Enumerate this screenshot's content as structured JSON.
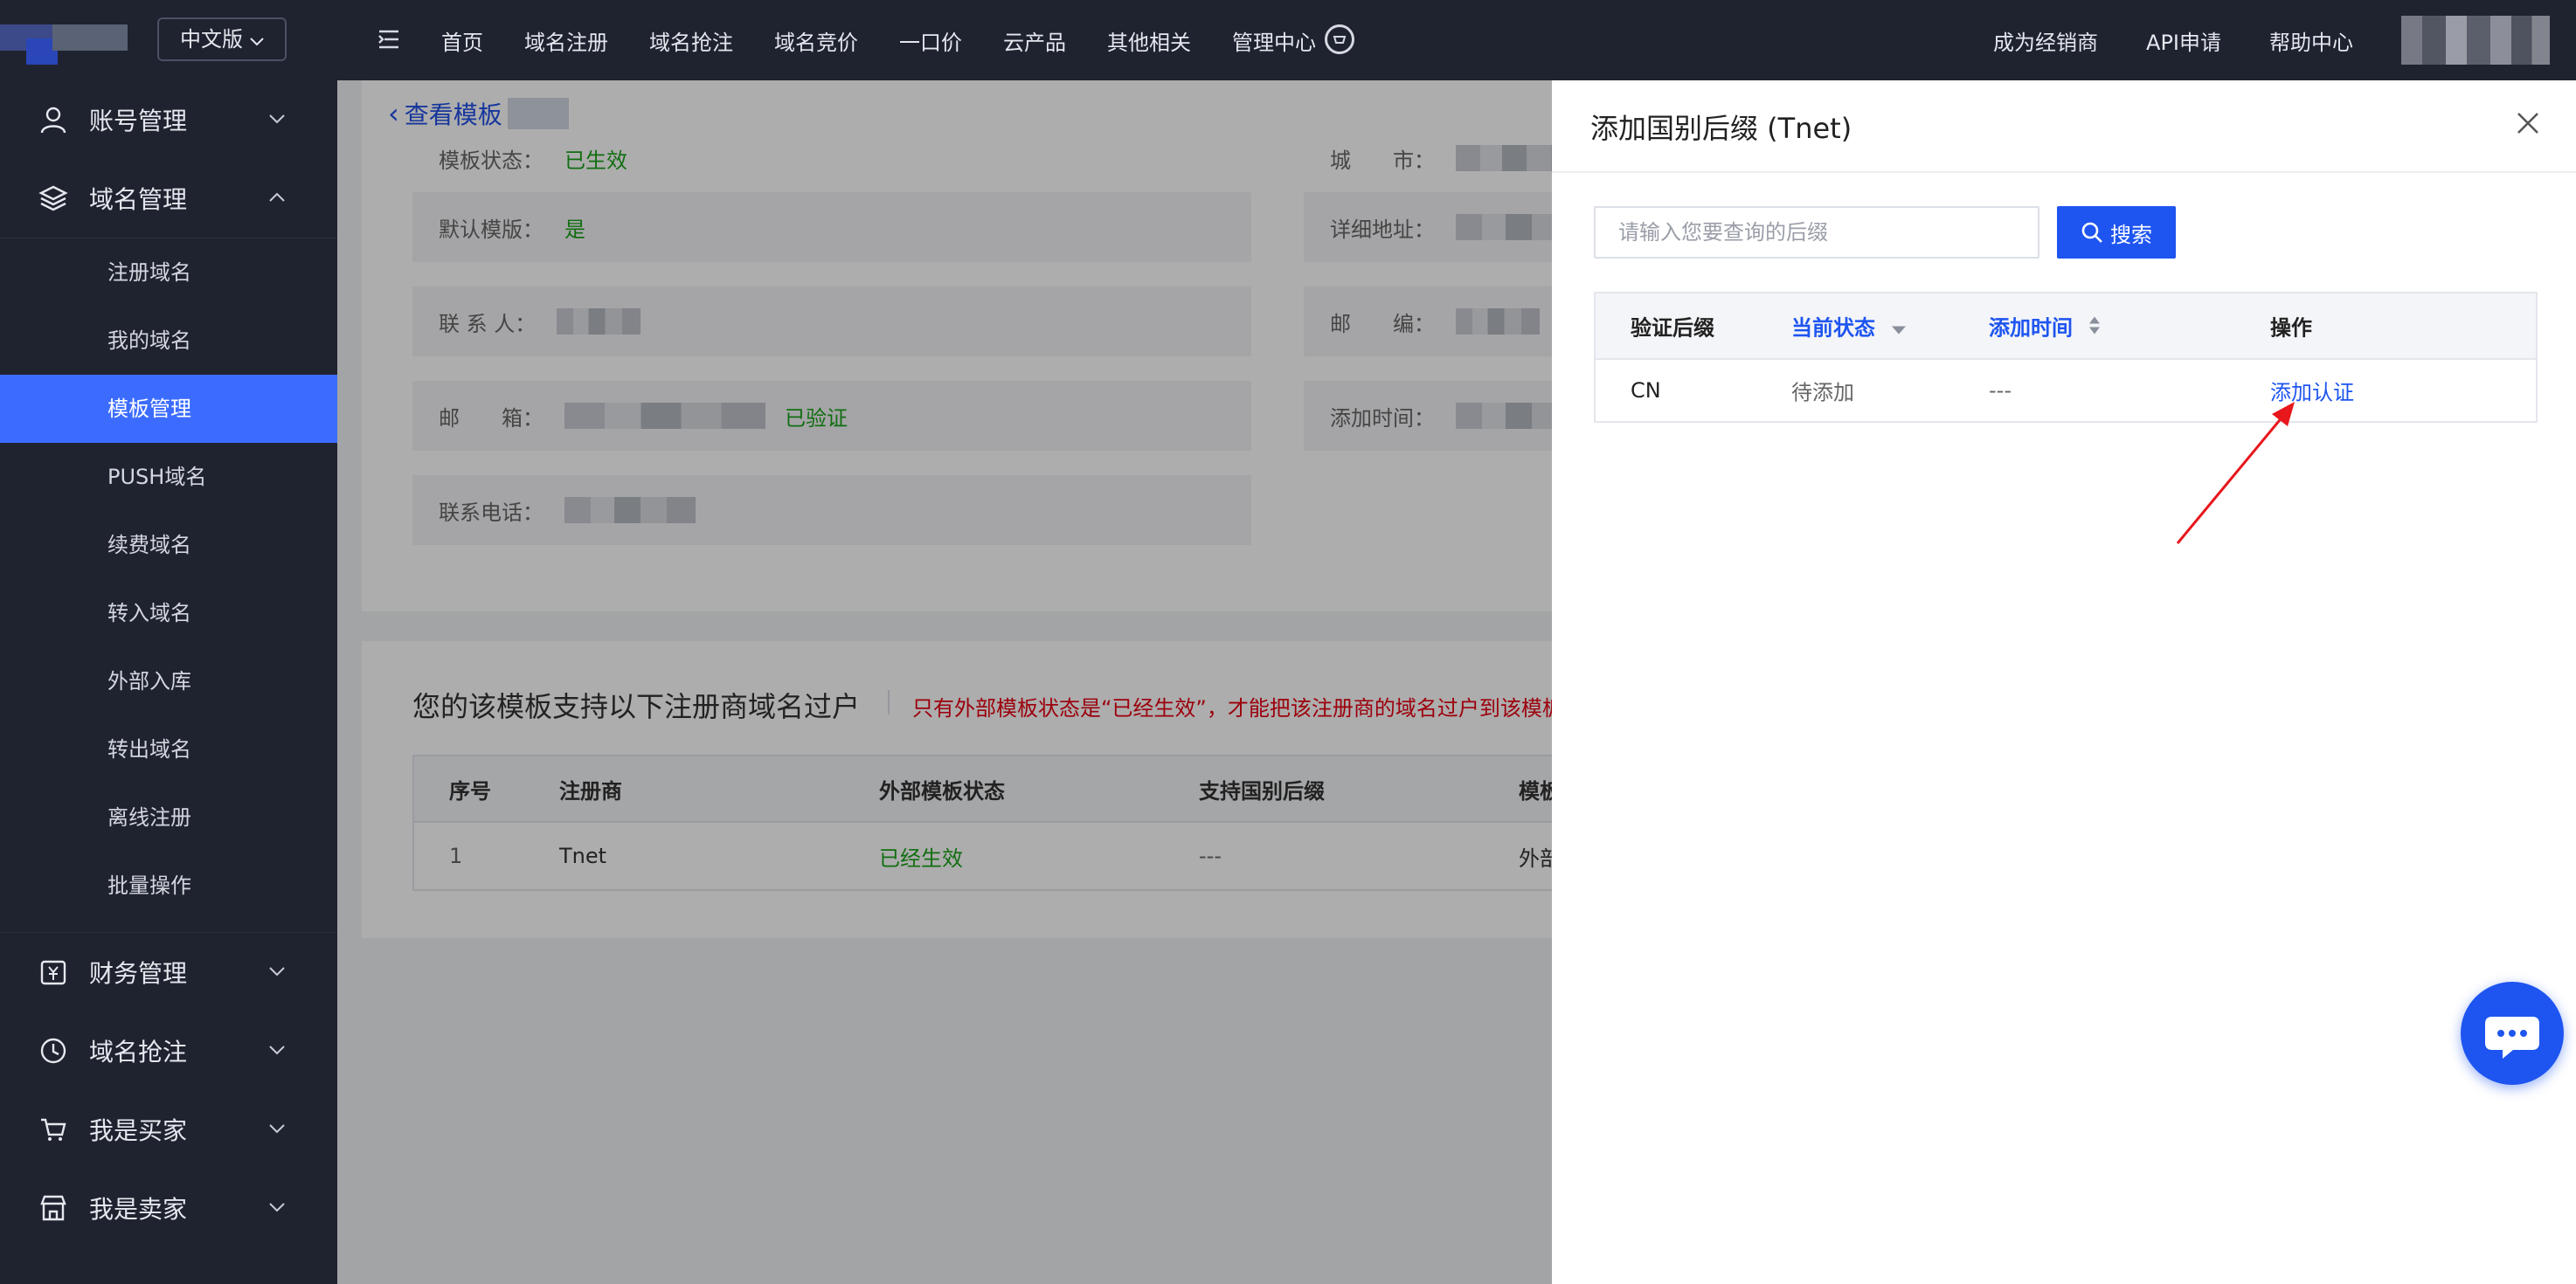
{
  "topbar": {
    "lang": "中文版",
    "nav": [
      "首页",
      "域名注册",
      "域名抢注",
      "域名竞价",
      "一口价",
      "云产品",
      "其他相关",
      "管理中心"
    ],
    "right_nav": [
      "成为经销商",
      "API申请",
      "帮助中心"
    ]
  },
  "sidebar": {
    "account": "账号管理",
    "domain": "域名管理",
    "sub_items": [
      "注册域名",
      "我的域名",
      "模板管理",
      "PUSH域名",
      "续费域名",
      "转入域名",
      "外部入库",
      "转出域名",
      "离线注册",
      "批量操作"
    ],
    "active_index": 2,
    "finance": "财务管理",
    "snatch": "域名抢注",
    "buyer": "我是买家",
    "seller": "我是卖家"
  },
  "main": {
    "back_label": "查看模板",
    "fields": {
      "template_status_label": "模板状态：",
      "template_status_value": "已生效",
      "city_label": "城　　市：",
      "default_label": "默认模版：",
      "default_value": "是",
      "address_label": "详细地址：",
      "contact_label": "联 系 人：",
      "postcode_label": "邮　　编：",
      "email_label": "邮　　箱：",
      "email_verified": "已验证",
      "added_label": "添加时间：",
      "phone_label": "联系电话："
    },
    "card2": {
      "heading": "您的该模板支持以下注册商域名过户",
      "warning": "只有外部模板状态是“已经生效”，才能把该注册商的域名过户到该模板下",
      "columns": [
        "序号",
        "注册商",
        "外部模板状态",
        "支持国别后缀",
        "模板"
      ],
      "row": [
        "1",
        "Tnet",
        "已经生效",
        "---",
        "外部"
      ]
    }
  },
  "drawer": {
    "title": "添加国别后缀 (Tnet)",
    "search_placeholder": "请输入您要查询的后缀",
    "search_label": "搜索",
    "columns": {
      "suffix": "验证后缀",
      "status": "当前状态",
      "added": "添加时间",
      "action": "操作"
    },
    "row": {
      "suffix": "CN",
      "status": "待添加",
      "added": "---",
      "action": "添加认证"
    }
  },
  "colors": {
    "topbar_bg": "#1f2330",
    "accent": "#1e55f0",
    "active_item": "#3b6cff",
    "success": "#1aa31a",
    "warning": "#e60012"
  }
}
